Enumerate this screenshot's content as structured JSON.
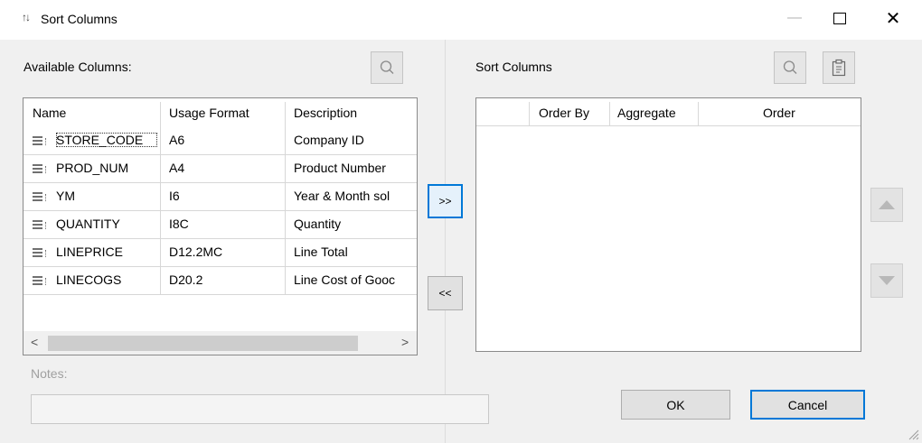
{
  "window": {
    "title": "Sort Columns",
    "title_icon": "sort-arrows-icon",
    "minimize": "—",
    "close": "✕"
  },
  "available": {
    "label": "Available Columns:",
    "headers": [
      "Name",
      "Usage Format",
      "Description"
    ],
    "rows": [
      {
        "name": "STORE_CODE",
        "format": "A6",
        "description": "Company ID"
      },
      {
        "name": "PROD_NUM",
        "format": "A4",
        "description": "Product Number"
      },
      {
        "name": "YM",
        "format": "I6",
        "description": "Year & Month sol"
      },
      {
        "name": "QUANTITY",
        "format": "I8C",
        "description": "Quantity"
      },
      {
        "name": "LINEPRICE",
        "format": "D12.2MC",
        "description": "Line Total"
      },
      {
        "name": "LINECOGS",
        "format": "D20.2",
        "description": "Line Cost of Gooc"
      }
    ],
    "scroll_left": "<",
    "scroll_right": ">"
  },
  "move": {
    "add_label": ">>",
    "remove_label": "<<"
  },
  "sort": {
    "label": "Sort Columns",
    "headers": [
      "Order By",
      "Aggregate",
      "Order"
    ]
  },
  "notes": {
    "label": "Notes:",
    "value": ""
  },
  "buttons": {
    "ok": "OK",
    "cancel": "Cancel"
  },
  "colors": {
    "accent": "#0078d7",
    "background": "#f0f0f0"
  }
}
